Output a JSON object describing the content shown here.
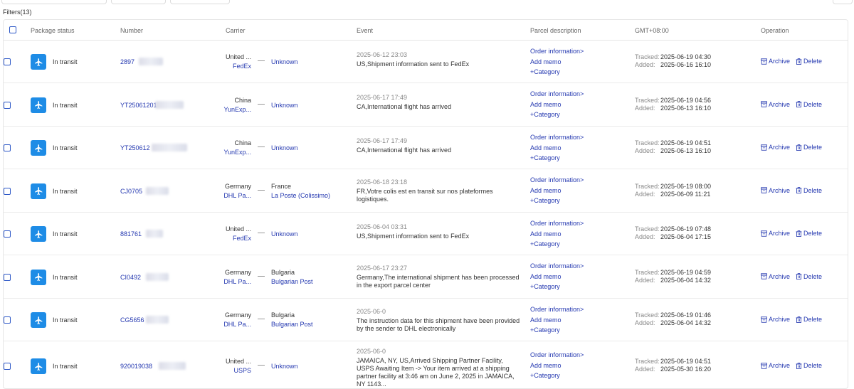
{
  "filters_label": "Filters(13)",
  "columns": {
    "status": "Package status",
    "number": "Number",
    "carrier": "Carrier",
    "event": "Event",
    "parcel": "Parcel description",
    "tz": "GMT+08:00",
    "operation": "Operation"
  },
  "labels": {
    "order_info": "Order information>",
    "add_memo": "Add memo",
    "category": "+Category",
    "tracked": "Tracked:",
    "added": "Added:",
    "archive": "Archive",
    "delete": "Delete"
  },
  "colors": {
    "accent": "#2438b0",
    "plane_bg": "#1e8ce6",
    "checkbox": "#2c57c7"
  },
  "rows": [
    {
      "status": "In transit",
      "number": "2897",
      "from_country": "United ...",
      "from_carrier": "FedEx",
      "to_country": "",
      "to_carrier": "Unknown",
      "event_time": "2025-06-12 23:03",
      "event_desc": "US,Shipment information sent to FedEx",
      "tracked": "2025-06-19 04:30",
      "added": "2025-06-16 16:10"
    },
    {
      "status": "In transit",
      "number": "YT25061201",
      "from_country": "China",
      "from_carrier": "YunExp...",
      "to_country": "",
      "to_carrier": "Unknown",
      "event_time": "2025-06-17 17:49",
      "event_desc": "CA,International flight has arrived",
      "tracked": "2025-06-19 04:56",
      "added": "2025-06-13 16:10"
    },
    {
      "status": "In transit",
      "number": "YT250612",
      "from_country": "China",
      "from_carrier": "YunExp...",
      "to_country": "",
      "to_carrier": "Unknown",
      "event_time": "2025-06-17 17:49",
      "event_desc": "CA,International flight has arrived",
      "tracked": "2025-06-19 04:51",
      "added": "2025-06-13 16:10"
    },
    {
      "status": "In transit",
      "number": "CJ0705",
      "from_country": "Germany",
      "from_carrier": "DHL Pa...",
      "to_country": "France",
      "to_carrier": "La Poste (Colissimo)",
      "event_time": "2025-06-18 23:18",
      "event_desc": "FR,Votre colis est en transit sur nos plateformes logistiques.",
      "tracked": "2025-06-19 08:00",
      "added": "2025-06-09 11:21"
    },
    {
      "status": "In transit",
      "number": "881761",
      "from_country": "United ...",
      "from_carrier": "FedEx",
      "to_country": "",
      "to_carrier": "Unknown",
      "event_time": "2025-06-04 03:31",
      "event_desc": "US,Shipment information sent to FedEx",
      "tracked": "2025-06-19 07:48",
      "added": "2025-06-04 17:15"
    },
    {
      "status": "In transit",
      "number": "CI0492",
      "from_country": "Germany",
      "from_carrier": "DHL Pa...",
      "to_country": "Bulgaria",
      "to_carrier": "Bulgarian Post",
      "event_time": "2025-06-17 23:27",
      "event_desc": "Germany,The international shipment has been processed in the export parcel center",
      "tracked": "2025-06-19 04:59",
      "added": "2025-06-04 14:32"
    },
    {
      "status": "In transit",
      "number": "CG5656",
      "from_country": "Germany",
      "from_carrier": "DHL Pa...",
      "to_country": "Bulgaria",
      "to_carrier": "Bulgarian Post",
      "event_time": "2025-06-0",
      "event_desc": "The instruction data for this shipment have been provided by the sender to DHL electronically",
      "tracked": "2025-06-19 01:46",
      "added": "2025-06-04 14:32"
    },
    {
      "status": "In transit",
      "number": "920019038",
      "from_country": "United ...",
      "from_carrier": "USPS",
      "to_country": "",
      "to_carrier": "Unknown",
      "event_time": "2025-06-0",
      "event_desc": "JAMAICA, NY, US,Arrived Shipping Partner Facility, USPS Awaiting Item -> Your item arrived at a shipping partner facility at 3:46 am on June 2, 2025 in JAMAICA, NY 1143...",
      "tracked": "2025-06-19 04:51",
      "added": "2025-05-30 16:20"
    }
  ]
}
